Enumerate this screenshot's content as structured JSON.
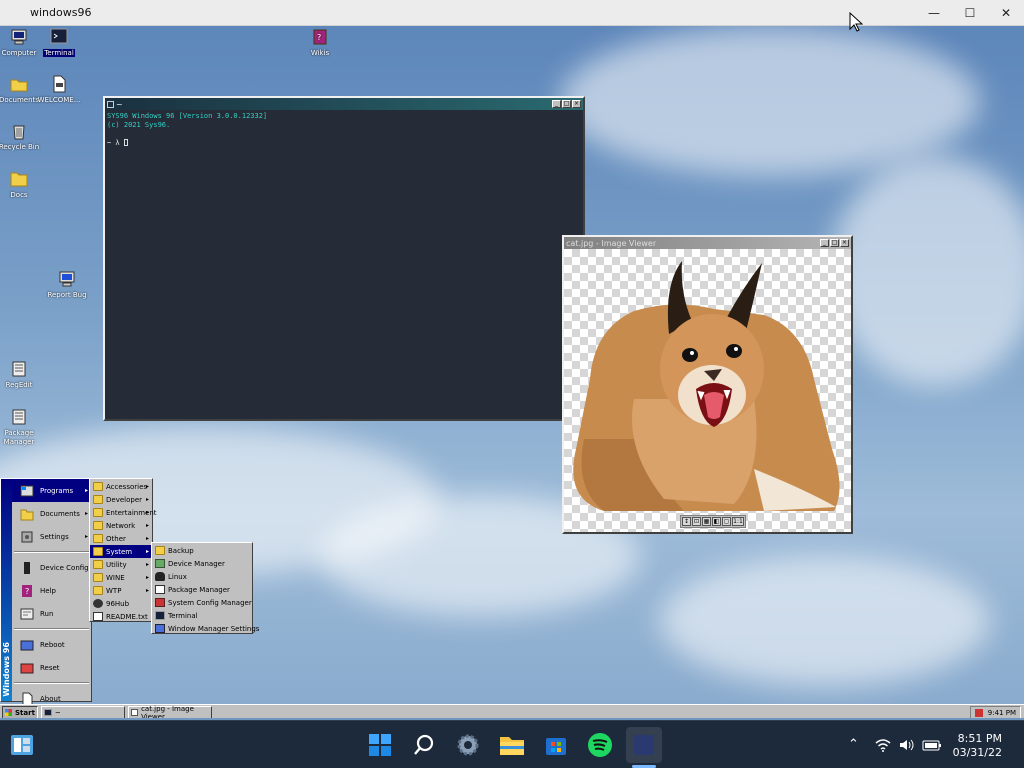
{
  "host_window": {
    "title": "windows96",
    "minimize": "—",
    "maximize": "☐",
    "close": "✕"
  },
  "desktop_icons": [
    {
      "label": "Computer"
    },
    {
      "label": "Terminal"
    },
    {
      "label": "Wikis"
    },
    {
      "label": "Documents"
    },
    {
      "label": "WELCOME..."
    },
    {
      "label": "Recycle Bin"
    },
    {
      "label": "Docs"
    },
    {
      "label": "Report Bug"
    },
    {
      "label": "RegEdit"
    },
    {
      "label": "Package Manager"
    }
  ],
  "terminal": {
    "title": "~",
    "line1": "SYS96 Windows 96 [Version 3.0.0.12332]",
    "line2": "(c) 2021 Sys96.",
    "prompt": "~ λ "
  },
  "image_viewer": {
    "title": "cat.jpg - Image Viewer",
    "tools": [
      "↕",
      "⊡",
      "▦",
      "◧",
      "▢",
      "1:1"
    ]
  },
  "start_menu": {
    "band": "Windows 96",
    "items": [
      {
        "label": "Programs",
        "arrow": "▸"
      },
      {
        "label": "Documents",
        "arrow": "▸"
      },
      {
        "label": "Settings",
        "arrow": "▸"
      },
      {
        "label": "Device Config"
      },
      {
        "label": "Help"
      },
      {
        "label": "Run"
      },
      {
        "label": "Reboot"
      },
      {
        "label": "Reset"
      },
      {
        "label": "About"
      }
    ]
  },
  "programs_menu": {
    "items": [
      {
        "label": "Accessories"
      },
      {
        "label": "Developer"
      },
      {
        "label": "Entertainment"
      },
      {
        "label": "Network"
      },
      {
        "label": "Other"
      },
      {
        "label": "System"
      },
      {
        "label": "Utility"
      },
      {
        "label": "WINE"
      },
      {
        "label": "WTP"
      },
      {
        "label": "96Hub"
      },
      {
        "label": "README.txt"
      }
    ],
    "arrow": "▸"
  },
  "system_menu": {
    "items": [
      {
        "label": "Backup"
      },
      {
        "label": "Device Manager"
      },
      {
        "label": "Linux"
      },
      {
        "label": "Package Manager"
      },
      {
        "label": "System Config Manager"
      },
      {
        "label": "Terminal"
      },
      {
        "label": "Window Manager Settings"
      }
    ]
  },
  "w96_taskbar": {
    "start_label": "Start",
    "task_terminal": "~",
    "task_image": "cat.jpg - Image Viewer",
    "tray_time": "9:41 PM"
  },
  "host_taskbar": {
    "time": "8:51 PM",
    "date": "03/31/22"
  },
  "colors": {
    "titlebar_active": "#000080",
    "terminal_bg": "#262b38",
    "terminal_text": "#30d2c4"
  }
}
